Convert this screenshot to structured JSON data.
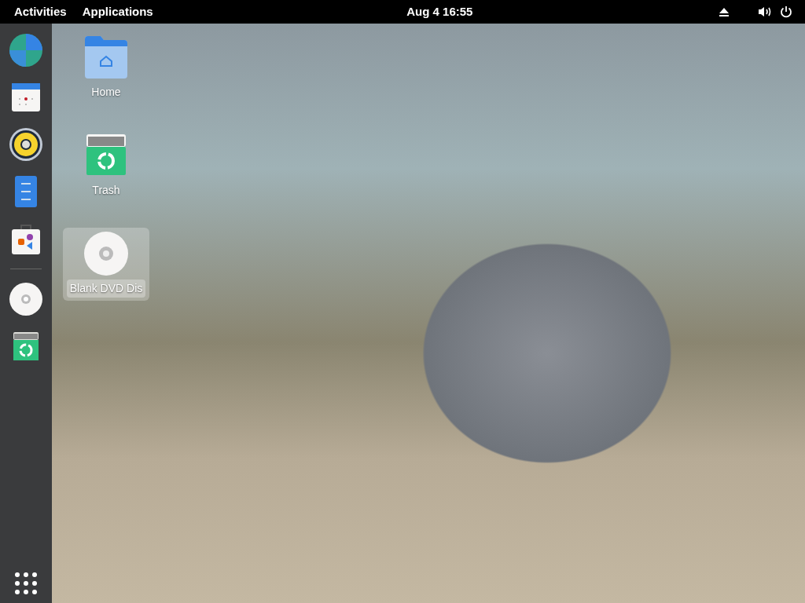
{
  "top_bar": {
    "activities": "Activities",
    "applications": "Applications",
    "clock": "Aug 4 16:55"
  },
  "desktop_icons": [
    {
      "label": "Home",
      "kind": "folder",
      "selected": false
    },
    {
      "label": "Trash",
      "kind": "trash",
      "selected": false
    },
    {
      "label": "Blank DVD Dis",
      "kind": "disc",
      "selected": true
    }
  ]
}
